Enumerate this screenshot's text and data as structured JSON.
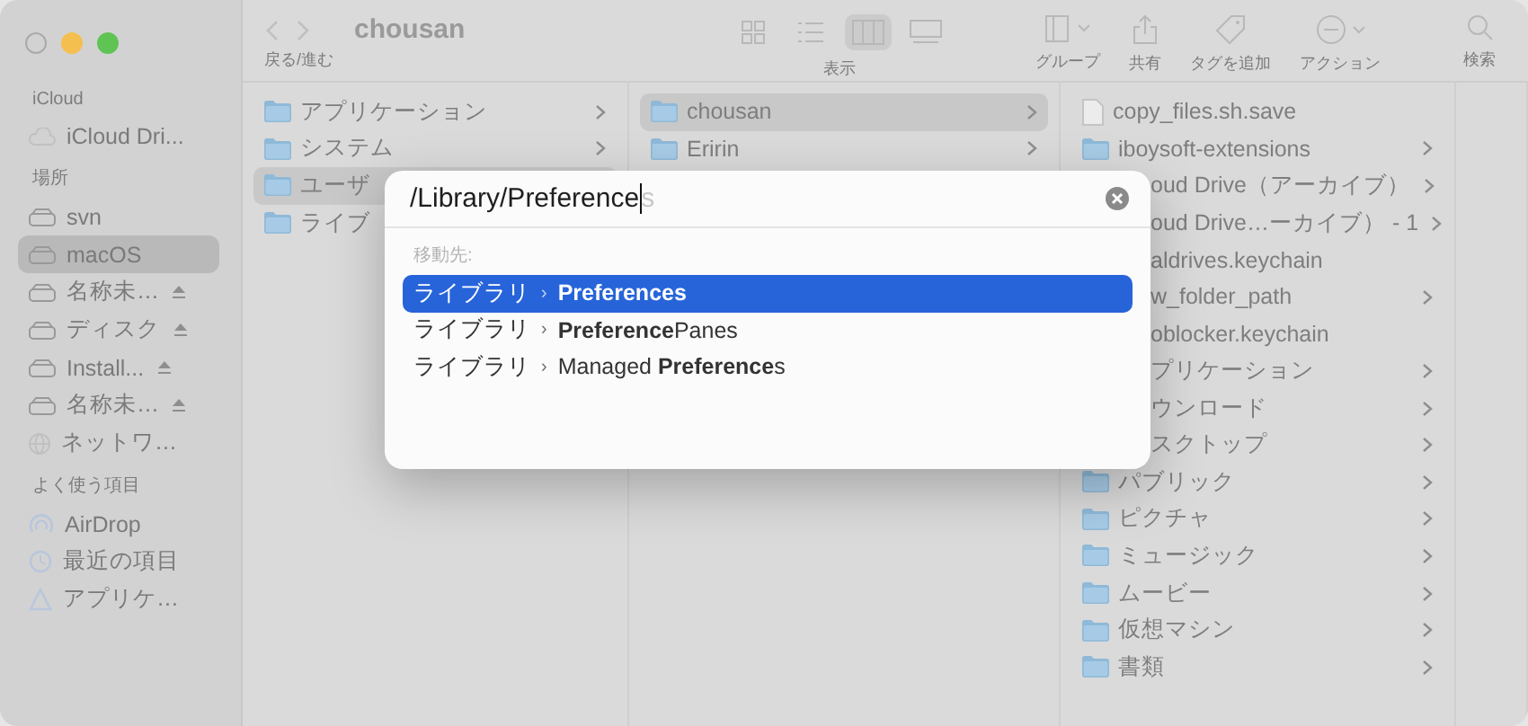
{
  "toolbar": {
    "title": "chousan",
    "nav_label": "戻る/進む",
    "view_label": "表示",
    "actions": [
      {
        "kind": "group",
        "label": "グループ"
      },
      {
        "kind": "share",
        "label": "共有"
      },
      {
        "kind": "tag",
        "label": "タグを追加"
      },
      {
        "kind": "action",
        "label": "アクション"
      },
      {
        "kind": "search",
        "label": "検索"
      }
    ],
    "views": [
      {
        "kind": "icons",
        "selected": false
      },
      {
        "kind": "list",
        "selected": false
      },
      {
        "kind": "columns",
        "selected": true
      },
      {
        "kind": "gallery",
        "selected": false
      }
    ]
  },
  "sidebar": [
    {
      "heading": "iCloud",
      "items": [
        {
          "label": "iCloud Dri...",
          "kind": "cloud",
          "selected": false,
          "eject": false
        }
      ]
    },
    {
      "heading": "場所",
      "items": [
        {
          "label": "svn",
          "kind": "drive",
          "selected": false,
          "eject": false
        },
        {
          "label": "macOS",
          "kind": "drive",
          "selected": true,
          "eject": false
        },
        {
          "label": "名称未…",
          "kind": "drive",
          "selected": false,
          "eject": true
        },
        {
          "label": "ディスク",
          "kind": "drive",
          "selected": false,
          "eject": true
        },
        {
          "label": "Install...",
          "kind": "drive",
          "selected": false,
          "eject": true
        },
        {
          "label": "名称未…",
          "kind": "drive",
          "selected": false,
          "eject": true
        },
        {
          "label": "ネットワ…",
          "kind": "network",
          "selected": false,
          "eject": false
        }
      ]
    },
    {
      "heading": "よく使う項目",
      "items": [
        {
          "label": "AirDrop",
          "kind": "airdrop",
          "selected": false,
          "eject": false
        },
        {
          "label": "最近の項目",
          "kind": "recent",
          "selected": false,
          "eject": false
        },
        {
          "label": "アプリケ…",
          "kind": "apps",
          "selected": false,
          "eject": false
        }
      ]
    }
  ],
  "columns": [
    [
      {
        "label": "アプリケーション",
        "kind": "folder",
        "selected": false,
        "chevron": true
      },
      {
        "label": "システム",
        "kind": "folder",
        "selected": false,
        "chevron": true
      },
      {
        "label": "ユーザ",
        "kind": "folder",
        "selected": true
      },
      {
        "label": "ライブ",
        "kind": "folder",
        "selected": false
      }
    ],
    [
      {
        "label": "chousan",
        "kind": "folder",
        "selected": true,
        "chevron": true
      },
      {
        "label": "Eririn",
        "kind": "folder",
        "selected": false,
        "chevron": true
      }
    ],
    [
      {
        "label": "copy_files.sh.save",
        "kind": "file",
        "selected": false,
        "chevron": false
      },
      {
        "label": "iboysoft-extensions",
        "kind": "folder",
        "selected": false,
        "chevron": true
      },
      {
        "label": "oud Drive（アーカイブ）",
        "kind": "partial",
        "selected": false,
        "chevron": true
      },
      {
        "label": "oud Drive…ーカイブ） - 1",
        "kind": "partial",
        "selected": false,
        "chevron": true
      },
      {
        "label": "aldrives.keychain",
        "kind": "partial",
        "selected": false,
        "chevron": false
      },
      {
        "label": "w_folder_path",
        "kind": "partial",
        "selected": false,
        "chevron": true
      },
      {
        "label": "oblocker.keychain",
        "kind": "partial",
        "selected": false,
        "chevron": false
      },
      {
        "label": "プリケーション",
        "kind": "partial",
        "selected": false,
        "chevron": true
      },
      {
        "label": "ウンロード",
        "kind": "partial",
        "selected": false,
        "chevron": true
      },
      {
        "label": "スクトップ",
        "kind": "partial",
        "selected": false,
        "chevron": true
      },
      {
        "label": "パブリック",
        "kind": "folder",
        "selected": false,
        "chevron": true
      },
      {
        "label": "ピクチャ",
        "kind": "folder",
        "selected": false,
        "chevron": true
      },
      {
        "label": "ミュージック",
        "kind": "folder",
        "selected": false,
        "chevron": true
      },
      {
        "label": "ムービー",
        "kind": "folder",
        "selected": false,
        "chevron": true
      },
      {
        "label": "仮想マシン",
        "kind": "folder",
        "selected": false,
        "chevron": true
      },
      {
        "label": "書類",
        "kind": "folder",
        "selected": false,
        "chevron": true
      }
    ]
  ],
  "goto": {
    "value": "/Library/Preference",
    "completion": "s",
    "section": "移動先:",
    "results": [
      {
        "parent": "ライブラリ",
        "separator": "›",
        "name": "**Preferences**",
        "selected": true
      },
      {
        "parent": "ライブラリ",
        "separator": "›",
        "name": "**Preference**Panes",
        "selected": false
      },
      {
        "parent": "ライブラリ",
        "separator": "›",
        "name": "Managed **Preference**s",
        "selected": false
      }
    ]
  }
}
